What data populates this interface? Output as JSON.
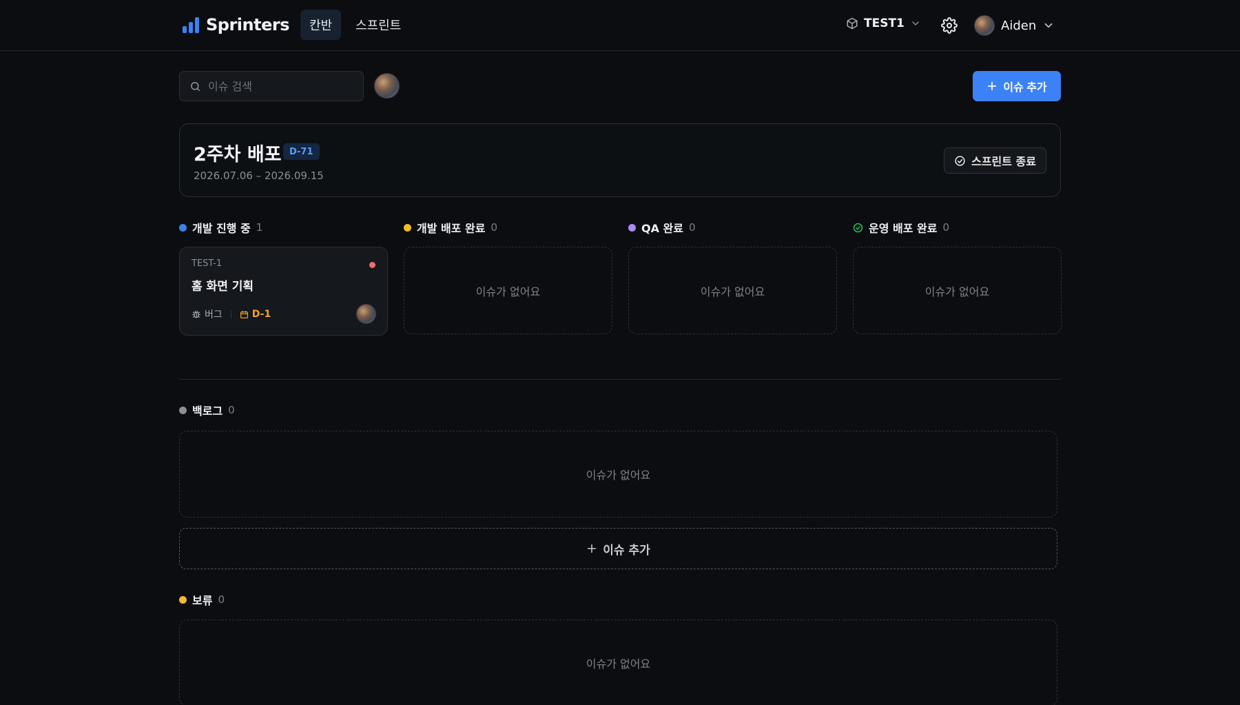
{
  "header": {
    "logo_text": "Sprinters",
    "tabs": [
      {
        "label": "칸반",
        "active": true
      },
      {
        "label": "스프린트",
        "active": false
      }
    ],
    "project_name": "TEST1",
    "user_name": "Aiden"
  },
  "toolbar": {
    "search_placeholder": "이슈 검색",
    "add_issue_label": "이슈 추가"
  },
  "sprint": {
    "title": "2주차 배포",
    "dday": "D-71",
    "dates": "2026.07.06 – 2026.09.15",
    "end_button_label": "스프린트 종료"
  },
  "columns": [
    {
      "title": "개발 진행 중",
      "count": "1",
      "color": "#3b82f6"
    },
    {
      "title": "개발 배포 완료",
      "count": "0",
      "color": "#f5b82e",
      "empty_text": "이슈가 없어요"
    },
    {
      "title": "QA 완료",
      "count": "0",
      "color": "#a78bfa",
      "empty_text": "이슈가 없어요"
    },
    {
      "title": "운영 배포 완료",
      "count": "0",
      "color": "#22c55e",
      "empty_text": "이슈가 없어요"
    }
  ],
  "issues": [
    {
      "key": "TEST-1",
      "title": "홈 화면 기획",
      "type": "버그",
      "due": "D-1",
      "priority_color": "#f26d6d"
    }
  ],
  "backlog": {
    "title": "백로그",
    "count": "0",
    "empty_text": "이슈가 없어요",
    "add_label": "이슈 추가"
  },
  "hold": {
    "title": "보류",
    "count": "0",
    "empty_text": "이슈가 없어요"
  },
  "colors": {
    "background": "#0b0d10",
    "accent": "#3b82f6",
    "warning": "#f5a524",
    "danger": "#f26d6d"
  }
}
